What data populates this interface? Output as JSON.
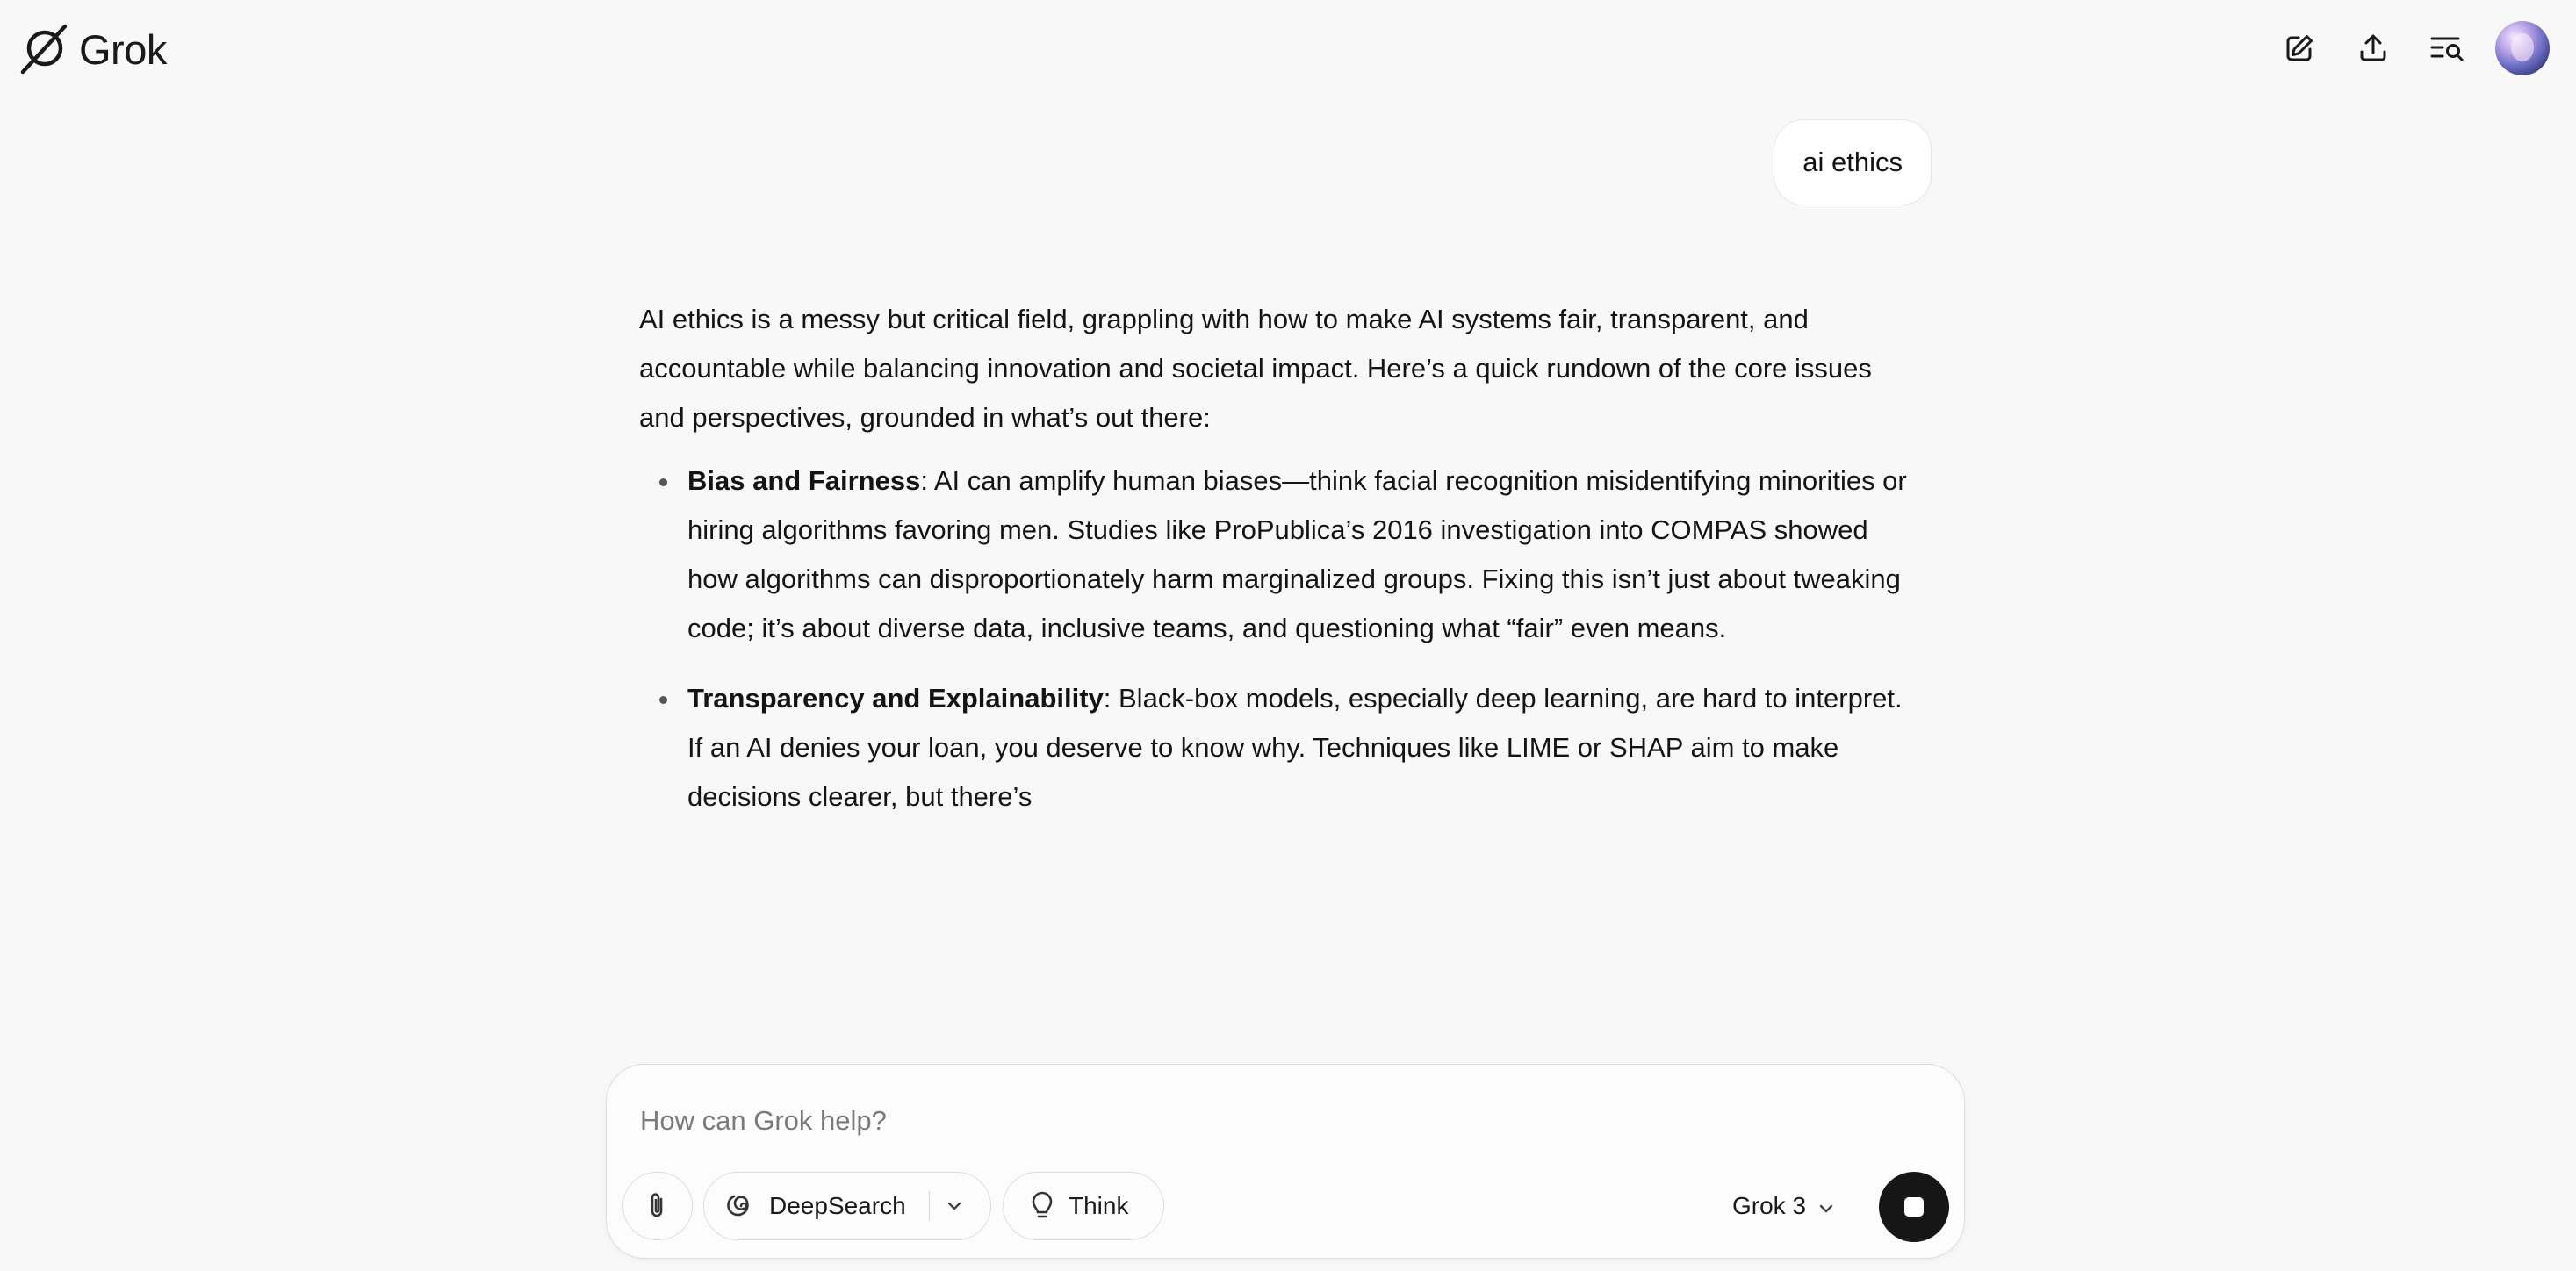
{
  "header": {
    "logo_text": "Grok",
    "icons": [
      "new-chat-icon",
      "share-upload-icon",
      "search-history-icon"
    ]
  },
  "conversation": {
    "user_message": "ai ethics",
    "answer": {
      "intro": "AI ethics is a messy but critical field, grappling with how to make AI systems fair, transparent, and accountable while balancing innovation and societal impact. Here’s a quick rundown of the core issues and perspectives, grounded in what’s out there:",
      "bullets": [
        {
          "title": "Bias and Fairness",
          "text": ": AI can amplify human biases—think facial recognition misidentifying minorities or hiring algorithms favoring men. Studies like ProPublica’s 2016 investigation into COMPAS showed how algorithms can disproportionately harm marginalized groups. Fixing this isn’t just about tweaking code; it’s about diverse data, inclusive teams, and questioning what “fair” even means."
        },
        {
          "title": "Transparency and Explainability",
          "text": ": Black-box models, especially deep learning, are hard to interpret. If an AI denies your loan, you deserve to know why. Techniques like LIME or SHAP aim to make decisions clearer, but there’s"
        }
      ]
    }
  },
  "composer": {
    "placeholder": "How can Grok help?",
    "value": "",
    "deepsearch_label": "DeepSearch",
    "think_label": "Think",
    "model_label": "Grok 3"
  },
  "colors": {
    "background": "#f8f8f8",
    "stop_button": "#161616",
    "text": "#141414",
    "placeholder": "#7a7a7a"
  }
}
